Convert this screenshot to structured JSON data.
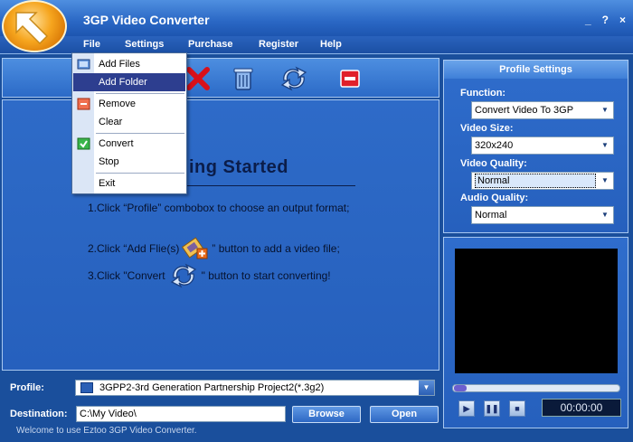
{
  "window": {
    "title": "3GP Video Converter",
    "minimize_label": "_",
    "help_label": "?",
    "close_label": "×"
  },
  "menubar": {
    "file": "File",
    "settings": "Settings",
    "purchase": "Purchase",
    "register": "Register",
    "help": "Help"
  },
  "file_menu": {
    "add_files": "Add Files",
    "add_folder": "Add Folder",
    "remove": "Remove",
    "clear": "Clear",
    "convert": "Convert",
    "stop": "Stop",
    "exit": "Exit",
    "highlighted": "add_folder"
  },
  "toolbar": {
    "icons": [
      "add-files-icon",
      "remove-icon",
      "clear-icon",
      "convert-icon",
      "stop-icon"
    ]
  },
  "getting_started": {
    "title": "Getting Started",
    "visible_title_fragment": "ing Started",
    "step1": "1.Click “Profile” combobox to choose an output format;",
    "step2_pre": "2.Click “Add Flie(s)",
    "step2_post": "” button to add a video file;",
    "step3_pre": "3.Click \"Convert",
    "step3_post": "\" button to start converting!"
  },
  "profile_settings": {
    "header": "Profile Settings",
    "function_label": "Function:",
    "function_value": "Convert Video To 3GP",
    "video_size_label": "Video Size:",
    "video_size_value": "320x240",
    "video_quality_label": "Video Quality:",
    "video_quality_value": "Normal",
    "audio_quality_label": "Audio Quality:",
    "audio_quality_value": "Normal"
  },
  "player": {
    "time": "00:00:00",
    "play_label": "▶",
    "pause_label": "❚❚",
    "stop_label": "■"
  },
  "bottom": {
    "profile_label": "Profile:",
    "profile_value": "3GPP2-3rd Generation Partnership Project2(*.3g2)",
    "destination_label": "Destination:",
    "destination_value": "C:\\My Video\\",
    "browse": "Browse",
    "open": "Open",
    "status": "Welcome to use Eztoo 3GP Video Converter."
  },
  "colors": {
    "background": "#1a4f9c",
    "panel": "#2a64c2",
    "menu_highlight": "#2d3e8f",
    "title_text": "#0b1d4a"
  }
}
